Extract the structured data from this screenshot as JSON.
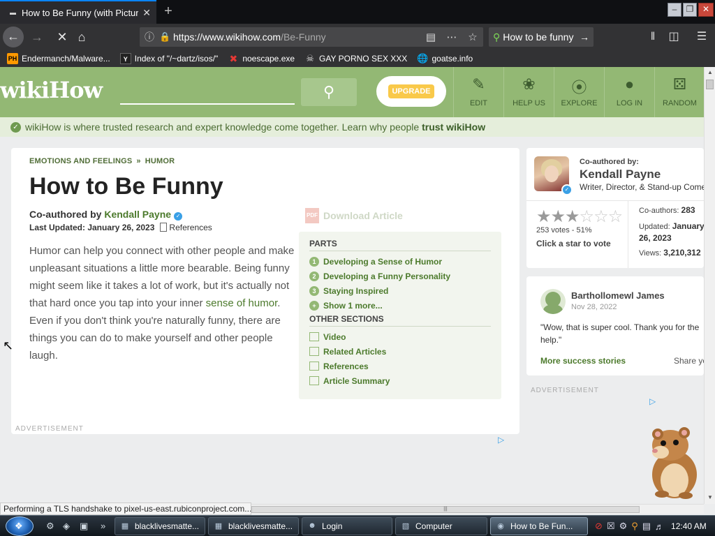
{
  "browser": {
    "tab_title": "How to Be Funny (with Pictures)",
    "url_host": "https://www.wikihow.com",
    "url_path": "/Be-Funny",
    "search_value": "How to be funny",
    "bookmarks": [
      {
        "label": "Endermanch/Malware..."
      },
      {
        "label": "Index of \"/~dartz/isos/\""
      },
      {
        "label": "noescape.exe"
      },
      {
        "label": "GAY PORNO SEX XXX"
      },
      {
        "label": "goatse.info"
      }
    ],
    "status_text": "Performing a TLS handshake to pixel-us-east.rubiconproject.com..."
  },
  "header": {
    "logo_wiki": "wiki",
    "logo_how": "How",
    "upgrade_label": "UPGRADE",
    "nav": [
      {
        "label": "EDIT"
      },
      {
        "label": "HELP US"
      },
      {
        "label": "EXPLORE"
      },
      {
        "label": "LOG IN"
      },
      {
        "label": "RANDOM"
      }
    ]
  },
  "trust": {
    "text": "wikiHow is where trusted research and expert knowledge come together. Learn why people ",
    "link": "trust wikiHow"
  },
  "article": {
    "crumb1": "EMOTIONS AND FEELINGS",
    "crumb_sep": "»",
    "crumb2": "HUMOR",
    "title": "How to Be Funny",
    "coauthored_prefix": "Co-authored by ",
    "author": "Kendall Payne",
    "updated_label": "Last Updated: January 26, 2023",
    "references_label": "References",
    "download_label": "Download Article",
    "intro_before": "Humor can help you connect with other people and make unpleasant situations a little more bearable. Being funny might seem like it takes a lot of work, but it's actually not that hard once you tap into your inner ",
    "intro_link": "sense of humor",
    "intro_after": ". Even if you don't think you're naturally funny, there are things you can do to make yourself and other people laugh.",
    "ad_label": "ADVERTISEMENT"
  },
  "toc": {
    "parts_header": "PARTS",
    "parts": [
      {
        "num": "1",
        "label": "Developing a Sense of Humor"
      },
      {
        "num": "2",
        "label": "Developing a Funny Personality"
      },
      {
        "num": "3",
        "label": "Staying Inspired"
      },
      {
        "num": "+",
        "label": "Show 1 more..."
      }
    ],
    "other_header": "OTHER SECTIONS",
    "other": [
      {
        "label": "Video"
      },
      {
        "label": "Related Articles"
      },
      {
        "label": "References"
      },
      {
        "label": "Article Summary"
      }
    ]
  },
  "side_author": {
    "coauthored_by": "Co-authored by:",
    "name": "Kendall Payne",
    "role": "Writer, Director, & Stand-up Comedian",
    "votes": "253 votes - 51%",
    "click_star": "Click a star to vote",
    "coauthors_label": "Co-authors: ",
    "coauthors_value": "283",
    "updated_label": "Updated: ",
    "updated_value": "January 26, 2023",
    "views_label": "Views: ",
    "views_value": "3,210,312",
    "rating_stars": 2.5
  },
  "side_story": {
    "user": "Barthollomewl James",
    "date": "Nov 28, 2022",
    "quote": "\"Wow, that is super cool. Thank you for the help.\"",
    "more": "More success stories",
    "share": "Share yours!",
    "ad_label": "ADVERTISEMENT"
  },
  "taskbar": {
    "tasks": [
      {
        "label": "blacklivesmatte..."
      },
      {
        "label": "blacklivesmatte..."
      },
      {
        "label": "Login"
      },
      {
        "label": "Computer"
      },
      {
        "label": "How to Be Fun..."
      }
    ],
    "clock": "12:40 AM"
  }
}
